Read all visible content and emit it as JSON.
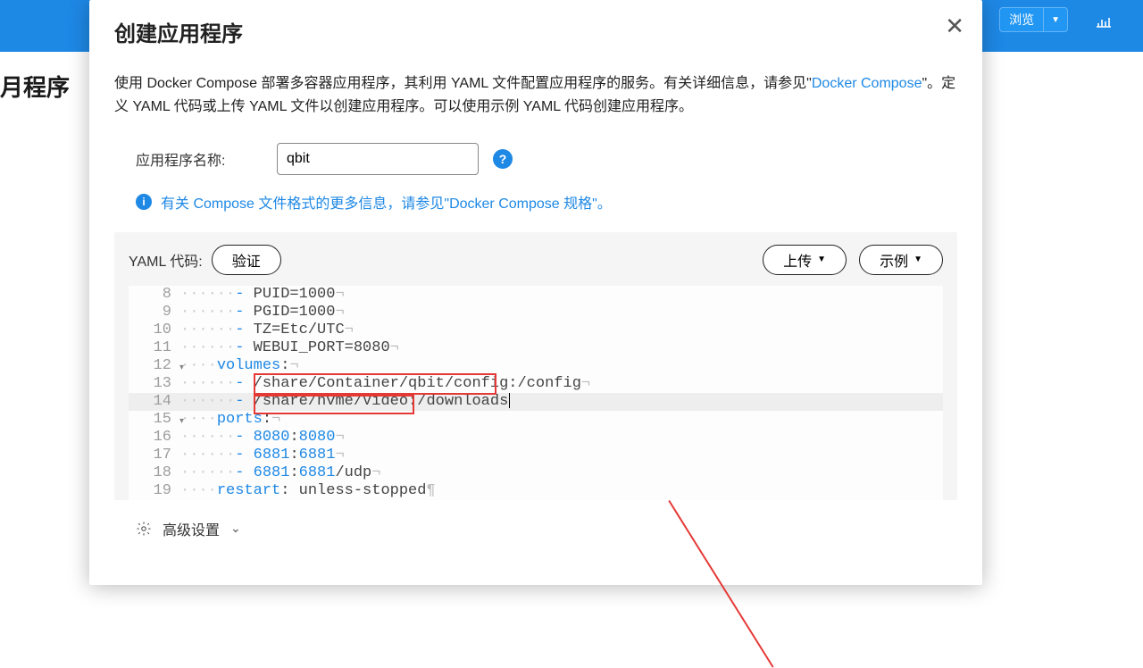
{
  "background": {
    "browse_label": "浏览",
    "page_heading_fragment": "月程序"
  },
  "modal": {
    "title": "创建应用程序",
    "desc_pre": "使用 Docker Compose 部署多容器应用程序，其利用 YAML 文件配置应用程序的服务。有关详细信息，请参见\"",
    "desc_link": "Docker Compose",
    "desc_post": "\"。定义 YAML 代码或上传 YAML 文件以创建应用程序。可以使用示例 YAML 代码创建应用程序。",
    "app_name_label": "应用程序名称:",
    "app_name_value": "qbit",
    "info_pre": "有关 Compose 文件格式的更多信息，请参见\"",
    "info_link": "Docker Compose 规格",
    "info_post": "\"。",
    "yaml_label": "YAML 代码:",
    "validate_btn": "验证",
    "upload_btn": "上传",
    "example_btn": "示例",
    "advanced_label": "高级设置",
    "code": {
      "l8": {
        "n": "8",
        "dots": "······",
        "dash": "- ",
        "rest": "PUID=1000"
      },
      "l9": {
        "n": "9",
        "dots": "······",
        "dash": "- ",
        "rest": "PGID=1000"
      },
      "l10": {
        "n": "10",
        "dots": "······",
        "dash": "- ",
        "rest": "TZ=Etc/UTC"
      },
      "l11": {
        "n": "11",
        "dots": "······",
        "dash": "- ",
        "rest": "WEBUI_PORT=8080"
      },
      "l12": {
        "n": "12",
        "dots": "····",
        "key": "volumes",
        "colon": ":"
      },
      "l13": {
        "n": "13",
        "dots": "······",
        "dash": "- ",
        "path": "/share/Container/qbit/config:",
        "map": "/config"
      },
      "l14": {
        "n": "14",
        "dots": "······",
        "dash": "- ",
        "path": "/share/nvme/Video:",
        "map": "/downloads"
      },
      "l15": {
        "n": "15",
        "dots": "····",
        "key": "ports",
        "colon": ":"
      },
      "l16": {
        "n": "16",
        "dots": "······",
        "dash": "- ",
        "p1": "8080",
        "sep": ":",
        "p2": "8080"
      },
      "l17": {
        "n": "17",
        "dots": "······",
        "dash": "- ",
        "p1": "6881",
        "sep": ":",
        "p2": "6881"
      },
      "l18": {
        "n": "18",
        "dots": "······",
        "dash": "- ",
        "p1": "6881",
        "sep": ":",
        "p2": "6881",
        "proto": "/udp"
      },
      "l19": {
        "n": "19",
        "dots": "····",
        "key": "restart",
        "colon": ": ",
        "val": "unless-stopped"
      }
    }
  }
}
